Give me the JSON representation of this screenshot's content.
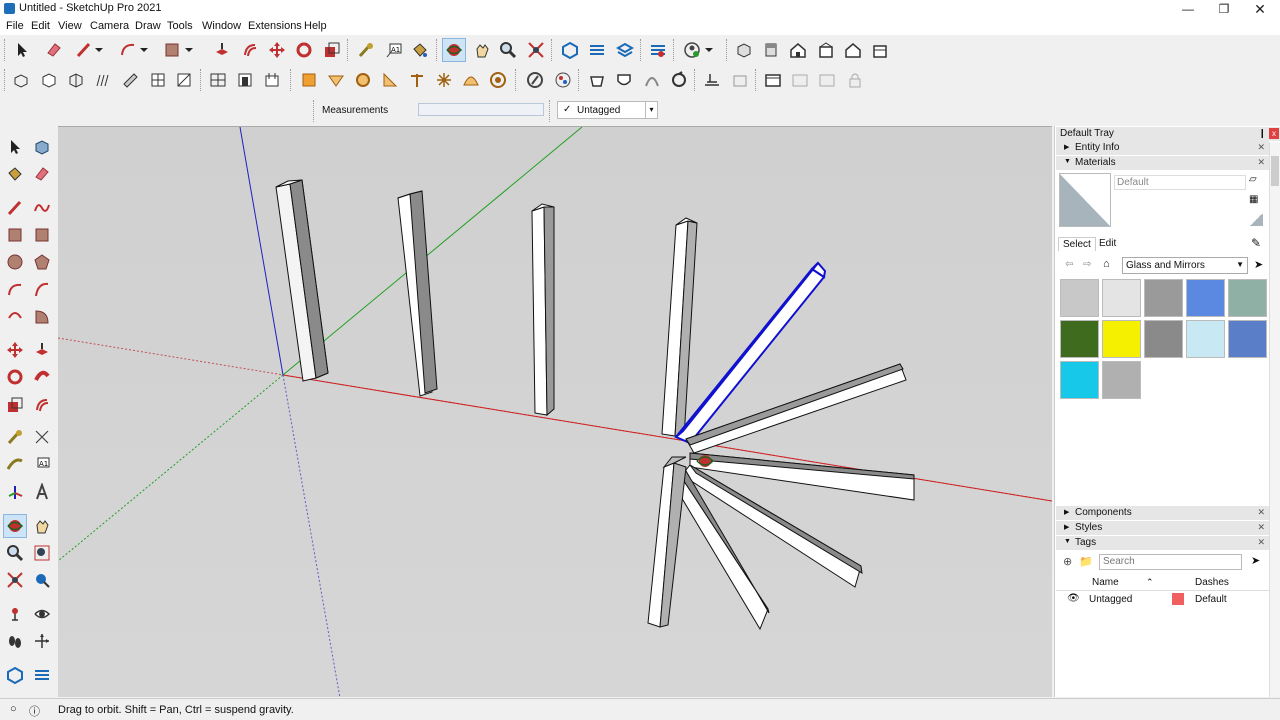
{
  "window": {
    "title": "Untitled - SketchUp Pro 2021",
    "min": "—",
    "max": "❐",
    "close": "✕"
  },
  "menu": [
    "File",
    "Edit",
    "View",
    "Camera",
    "Draw",
    "Tools",
    "Window",
    "Extensions",
    "Help"
  ],
  "measurements": {
    "label": "Measurements",
    "value": ""
  },
  "tag_dropdown": {
    "check": "✓",
    "value": "Untagged",
    "arrow": "▾"
  },
  "tray": {
    "title": "Default Tray",
    "pin": "❙",
    "close": "x",
    "entity_info": "Entity Info",
    "materials": {
      "label": "Materials",
      "current_name": "Default",
      "tab_select": "Select",
      "tab_edit": "Edit",
      "library": "Glass and Mirrors",
      "swatch_colors": [
        "#c8c8c8",
        "#e4e4e4",
        "#9a9a9a",
        "#5b88e0",
        "#8fb0a4",
        "#3f6b1e",
        "#f4f000",
        "#8a8a8a",
        "#c8e8f4",
        "#5a7ec8",
        "#18c8e8",
        "#b0b0b0"
      ]
    },
    "components": "Components",
    "styles": "Styles",
    "tags": {
      "label": "Tags",
      "search_placeholder": "Search",
      "col_name": "Name",
      "col_dashes": "Dashes",
      "sort": "⌃",
      "rows": [
        {
          "name": "Untagged",
          "color": "#f06060",
          "dashes": "Default"
        }
      ]
    }
  },
  "status": {
    "text": "Drag to orbit. Shift = Pan, Ctrl = suspend gravity."
  },
  "colors": {
    "red_axis": "#d02020",
    "green_axis": "#20a020",
    "blue_axis": "#2020c0",
    "selection": "#1010d0"
  }
}
